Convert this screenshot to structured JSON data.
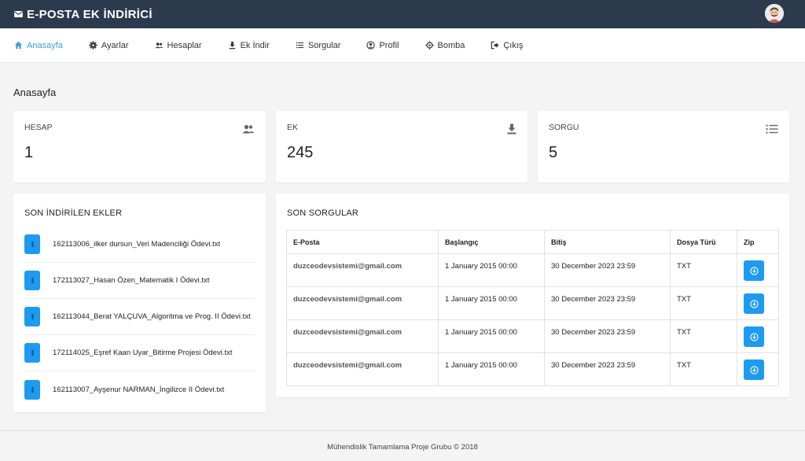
{
  "app": {
    "title": "E-POSTA EK İNDİRİCİ"
  },
  "nav": {
    "items": [
      {
        "label": "Anasayfa",
        "icon": "home-icon"
      },
      {
        "label": "Ayarlar",
        "icon": "gear-icon"
      },
      {
        "label": "Hesaplar",
        "icon": "users-icon"
      },
      {
        "label": "Ek İndir",
        "icon": "download-icon"
      },
      {
        "label": "Sorgular",
        "icon": "list-icon"
      },
      {
        "label": "Profil",
        "icon": "user-circle-icon"
      },
      {
        "label": "Bomba",
        "icon": "crosshair-icon"
      },
      {
        "label": "Çıkış",
        "icon": "sign-out-icon"
      }
    ]
  },
  "page": {
    "title": "Anasayfa"
  },
  "stats": {
    "accounts": {
      "label": "HESAP",
      "value": "1",
      "icon": "users-icon"
    },
    "attachments": {
      "label": "EK",
      "value": "245",
      "icon": "download-icon"
    },
    "queries": {
      "label": "SORGU",
      "value": "5",
      "icon": "list-icon"
    }
  },
  "recent_attachments": {
    "title": "SON İNDİRİLEN EKLER",
    "items": [
      "162113006_ilker dursun_Veri Madenciliği Ödevi.txt",
      "172113027_Hasan Özen_Matematik I Ödevi.txt",
      "162113044_Berat YALÇUVA_Algoritma ve Prog. II Ödevi.txt",
      "172114025_Eşref Kaan Uyar_Bitirme Projesi Ödevi.txt",
      "162113007_Ayşenur NARMAN_İngilizce II Ödevi.txt"
    ]
  },
  "recent_queries": {
    "title": "SON SORGULAR",
    "columns": [
      "E-Posta",
      "Başlangıç",
      "Bitiş",
      "Dosya Türü",
      "Zip"
    ],
    "rows": [
      {
        "email": "duzceodevsistemi@gmail.com",
        "start": "1 January 2015 00:00",
        "end": "30 December 2023 23:59",
        "type": "TXT"
      },
      {
        "email": "duzceodevsistemi@gmail.com",
        "start": "1 January 2015 00:00",
        "end": "30 December 2023 23:59",
        "type": "TXT"
      },
      {
        "email": "duzceodevsistemi@gmail.com",
        "start": "1 January 2015 00:00",
        "end": "30 December 2023 23:59",
        "type": "TXT"
      },
      {
        "email": "duzceodevsistemi@gmail.com",
        "start": "1 January 2015 00:00",
        "end": "30 December 2023 23:59",
        "type": "TXT"
      }
    ]
  },
  "footer": {
    "text": "Mühendislik Tamamlama Proje Grubu © 2018"
  },
  "colors": {
    "topbar": "#2c3a4e",
    "accent": "#3aa0db",
    "button": "#1e9bf0"
  }
}
